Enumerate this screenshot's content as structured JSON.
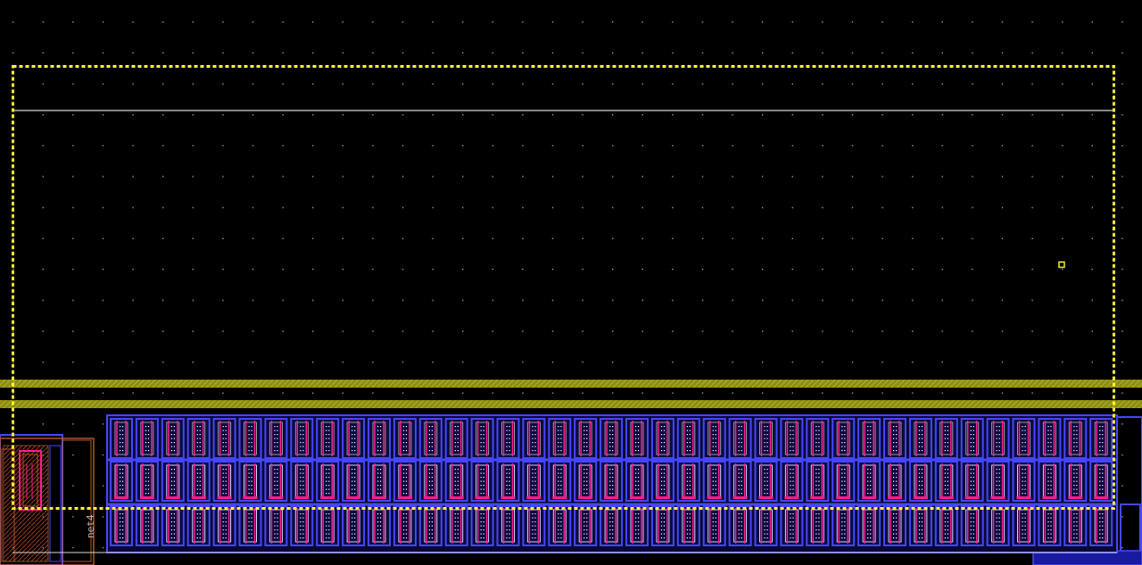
{
  "layout_view": {
    "background_color": "#000000",
    "grid_dot_color": "#9a9a9a",
    "selection_color": "#ffff33",
    "rail_color": "#9b9b1a",
    "cell_outline_color": "#4646ff",
    "poly_color": "#ff1e8c",
    "contact_color": "#ffffff",
    "net_label": {
      "text": "net4",
      "icon": "net-label-text"
    },
    "cell_array": {
      "columns": 39,
      "rows": 3
    }
  }
}
